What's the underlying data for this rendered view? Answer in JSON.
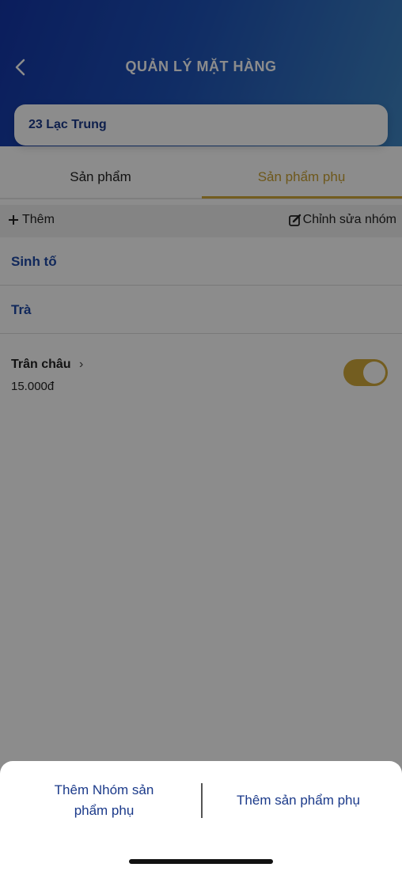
{
  "header": {
    "title": "QUẢN LÝ MẶT HÀNG"
  },
  "store": {
    "name": "23 Lạc Trung"
  },
  "tabs": [
    {
      "label": "Sản phẩm",
      "active": false
    },
    {
      "label": "Sản phẩm phụ",
      "active": true
    }
  ],
  "actions": {
    "add_label": "Thêm",
    "edit_label": "Chỉnh sửa nhóm"
  },
  "groups": [
    {
      "name": "Sinh tố"
    },
    {
      "name": "Trà"
    }
  ],
  "item": {
    "name": "Trân châu",
    "price": "15.000đ",
    "enabled": true
  },
  "sheet": {
    "option_1": "Thêm Nhóm sản phẩm phụ",
    "option_2": "Thêm sản phẩm phụ"
  },
  "colors": {
    "header_start": "#1436a8",
    "header_end": "#3f86c4",
    "accent": "#d2a93b",
    "link": "#1f4aa6"
  }
}
